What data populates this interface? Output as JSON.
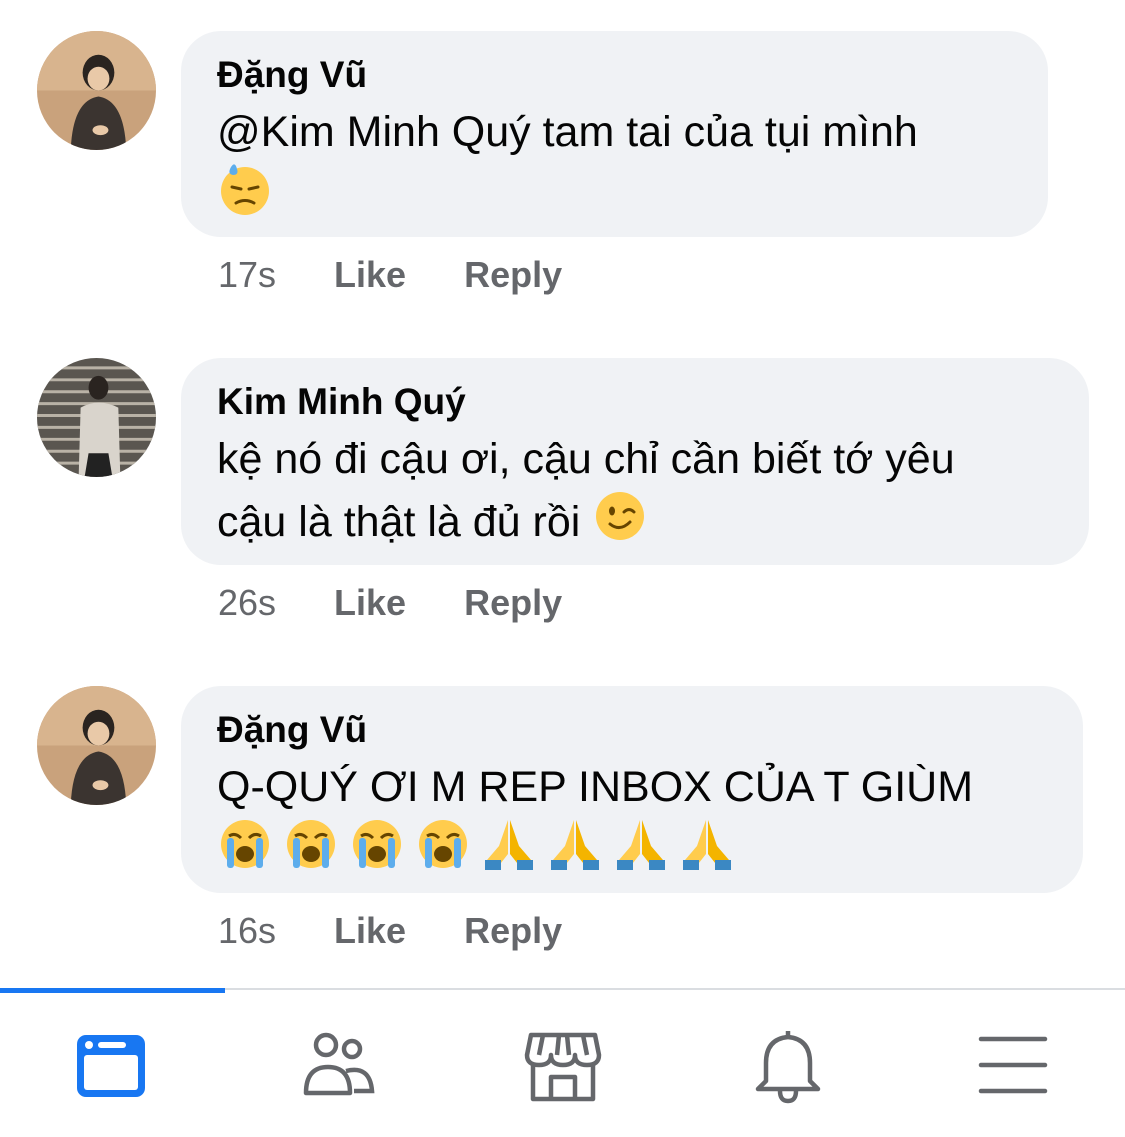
{
  "comments": [
    {
      "author": "Đặng Vũ",
      "text": "@Kim Minh Quý tam tai của tụi mình",
      "emojis": [
        "downcast-face-with-sweat"
      ],
      "time": "17s",
      "like": "Like",
      "reply": "Reply"
    },
    {
      "author": "Kim Minh Quý",
      "text_line1": "kệ nó đi cậu ơi, cậu chỉ cần biết tớ yêu",
      "text_line2": "cậu là thật là đủ rồi",
      "emojis": [
        "winking-face"
      ],
      "time": "26s",
      "like": "Like",
      "reply": "Reply"
    },
    {
      "author": "Đặng Vũ",
      "text": "Q-QUÝ ƠI M REP INBOX CỦA T GIÙM",
      "emojis": [
        "loudly-crying-face",
        "loudly-crying-face",
        "loudly-crying-face",
        "loudly-crying-face",
        "folded-hands",
        "folded-hands",
        "folded-hands",
        "folded-hands"
      ],
      "time": "16s",
      "like": "Like",
      "reply": "Reply"
    }
  ],
  "bottom_nav": {
    "items": [
      "feed-icon",
      "friends-icon",
      "marketplace-icon",
      "notifications-icon",
      "menu-icon"
    ],
    "active": "feed-icon"
  },
  "colors": {
    "bubble": "#f0f2f5",
    "text": "#050505",
    "meta": "#65676b",
    "accent": "#1877f2"
  }
}
